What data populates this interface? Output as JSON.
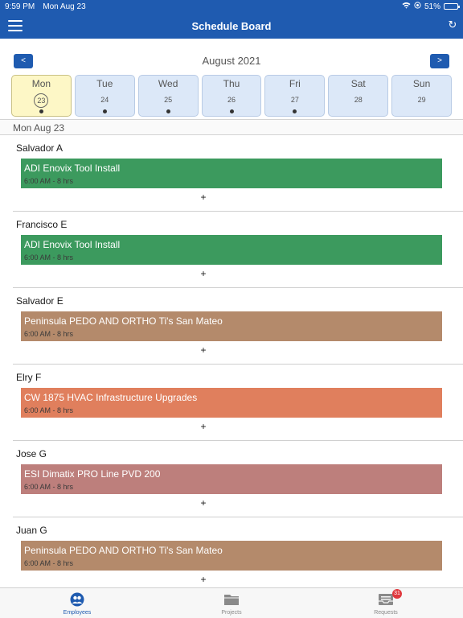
{
  "status_bar": {
    "time": "9:59 PM",
    "date": "Mon Aug 23",
    "battery": "51%"
  },
  "header": {
    "title": "Schedule Board"
  },
  "month_nav": {
    "prev_label": "<",
    "next_label": ">",
    "title": "August 2021"
  },
  "week": [
    {
      "name": "Mon",
      "num": "23",
      "selected": true,
      "dot": true
    },
    {
      "name": "Tue",
      "num": "24",
      "selected": false,
      "dot": true
    },
    {
      "name": "Wed",
      "num": "25",
      "selected": false,
      "dot": true
    },
    {
      "name": "Thu",
      "num": "26",
      "selected": false,
      "dot": true
    },
    {
      "name": "Fri",
      "num": "27",
      "selected": false,
      "dot": true
    },
    {
      "name": "Sat",
      "num": "28",
      "selected": false,
      "dot": false
    },
    {
      "name": "Sun",
      "num": "29",
      "selected": false,
      "dot": false
    }
  ],
  "selected_date": "Mon Aug 23",
  "employees": [
    {
      "name": "Salvador A",
      "job": "ADI Enovix Tool Install",
      "time": "6:00 AM - 8 hrs",
      "color": "#3c9a5e",
      "add": "+"
    },
    {
      "name": "Francisco E",
      "job": "ADI Enovix Tool Install",
      "time": "6:00 AM - 8 hrs",
      "color": "#3c9a5e",
      "add": "+"
    },
    {
      "name": "Salvador E",
      "job": "Peninsula PEDO AND ORTHO Ti's San Mateo",
      "time": "6:00 AM - 8 hrs",
      "color": "#b48a6b",
      "add": "+"
    },
    {
      "name": "Elry F",
      "job": "CW 1875 HVAC Infrastructure Upgrades",
      "time": "6:00 AM - 8 hrs",
      "color": "#e07f5d",
      "add": "+"
    },
    {
      "name": "Jose G",
      "job": "ESI Dimatix PRO Line PVD 200",
      "time": "6:00 AM - 8 hrs",
      "color": "#bd7f7c",
      "add": "+"
    },
    {
      "name": "Juan G",
      "job": "Peninsula PEDO AND ORTHO Ti's San Mateo",
      "time": "6:00 AM - 8 hrs",
      "color": "#b48a6b",
      "add": "+"
    }
  ],
  "tabs": [
    {
      "label": "Employees",
      "icon": "employees-icon",
      "active": true
    },
    {
      "label": "Projects",
      "icon": "folder-icon",
      "active": false
    },
    {
      "label": "Requests",
      "icon": "inbox-icon",
      "active": false,
      "badge": "31"
    }
  ],
  "colors": {
    "brand": "#1f5bb0",
    "selected_day": "#fdf7c6",
    "day_bg": "#dce8f8",
    "badge": "#e0393e"
  }
}
